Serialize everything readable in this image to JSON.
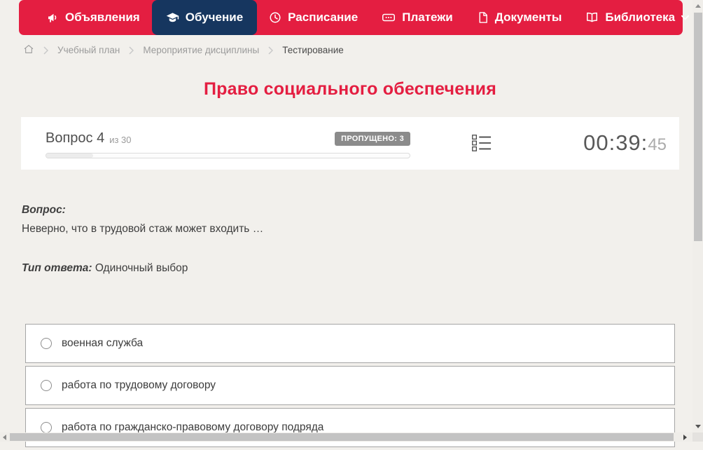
{
  "colors": {
    "accent": "#e41e41",
    "navy": "#16365f",
    "page-bg": "#f2f0ec",
    "card": "#ffffff",
    "text-dark": "#3e3e3e",
    "text-gray": "#9b9b9b",
    "border-gray": "#a5a5a5",
    "badge": "#8b8b8b",
    "thumb": "#c3c3c3",
    "track": "#f0eeea"
  },
  "nav": {
    "items": [
      {
        "label": "Объявления",
        "icon": "megaphone-icon",
        "active": false
      },
      {
        "label": "Обучение",
        "icon": "graduation-cap-icon",
        "active": true
      },
      {
        "label": "Расписание",
        "icon": "clock-icon",
        "active": false
      },
      {
        "label": "Платежи",
        "icon": "banknote-icon",
        "active": false
      },
      {
        "label": "Документы",
        "icon": "document-icon",
        "active": false
      },
      {
        "label": "Библиотека",
        "icon": "open-book-icon",
        "active": false,
        "has_dropdown": true
      }
    ]
  },
  "breadcrumb": {
    "items": [
      "Учебный план",
      "Мероприятие дисциплины",
      "Тестирование"
    ]
  },
  "page": {
    "title": "Право социального обеспечения"
  },
  "quiz": {
    "question_label": "Вопрос 4",
    "question_of": "из 30",
    "skipped_badge": "ПРОПУЩЕНО: 3",
    "progress_percent": 13,
    "timer": {
      "main": "00:39:",
      "seconds": "45"
    },
    "question_heading": "Вопрос:",
    "question_text": "Неверно, что в трудовой стаж может входить …",
    "answer_type_label": "Тип ответа:",
    "answer_type_value": "Одиночный выбор",
    "options": [
      {
        "label": "военная служба"
      },
      {
        "label": "работа по трудовому договору"
      },
      {
        "label": "работа по гражданско-правовому договору подряда"
      }
    ]
  }
}
